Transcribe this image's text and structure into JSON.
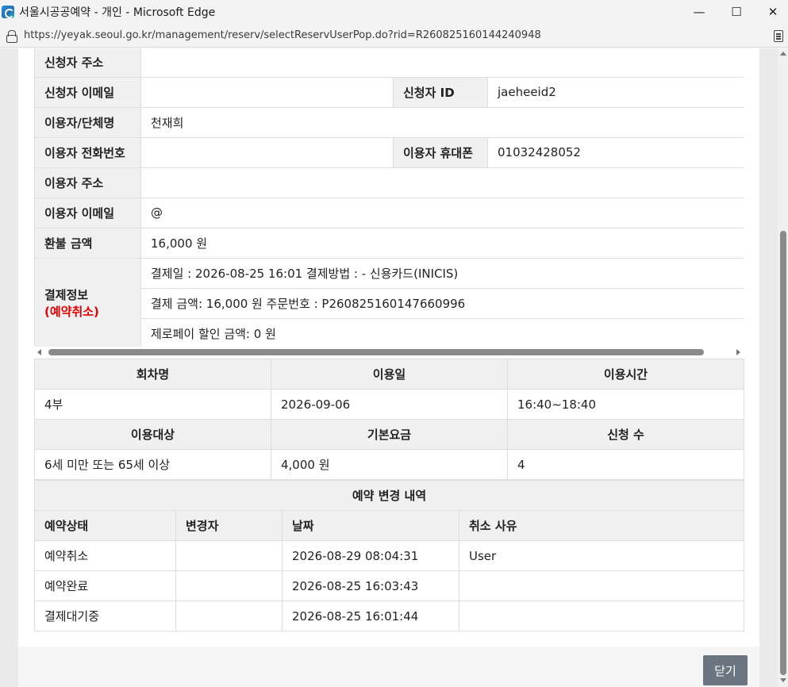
{
  "window": {
    "title": "서울시공공예약 - 개인 - Microsoft Edge",
    "url": "https://yeyak.seoul.go.kr/management/reserv/selectReservUserPop.do?rid=R260825160144240948",
    "controls": {
      "minimize": "—",
      "maximize": "☐",
      "close": "✕"
    }
  },
  "applicant": {
    "address_label": "신청자 주소",
    "address": "",
    "email_label": "신청자 이메일",
    "email": "",
    "id_label": "신청자 ID",
    "id": "jaeheeid2"
  },
  "user": {
    "name_label": "이용자/단체명",
    "name": "천재희",
    "phone_label": "이용자 전화번호",
    "phone": "",
    "mobile_label": "이용자 휴대폰",
    "mobile": "01032428052",
    "address_label": "이용자 주소",
    "address": "",
    "email_label": "이용자 이메일",
    "email": "@"
  },
  "refund": {
    "label": "환불 금액",
    "value": "16,000 원"
  },
  "payment": {
    "label": "결제정보",
    "status": "(예약취소)",
    "line1": "결제일 : 2026-08-25 16:01 결제방법 : - 신용카드(INICIS)",
    "line2": "결제 금액: 16,000 원 주문번호 : P260825160147660996",
    "line3": "제로페이 할인 금액: 0 원"
  },
  "session": {
    "headers": [
      "회차명",
      "이용일",
      "이용시간"
    ],
    "values": [
      "4부",
      "2026-09-06",
      "16:40~18:40"
    ]
  },
  "target": {
    "headers": [
      "이용대상",
      "기본요금",
      "신청 수"
    ],
    "values": [
      "6세 미만 또는 65세 이상",
      "4,000 원",
      "4"
    ]
  },
  "history": {
    "title": "예약 변경 내역",
    "headers": [
      "예약상태",
      "변경자",
      "날짜",
      "취소 사유"
    ],
    "rows": [
      [
        "예약취소",
        "",
        "2026-08-29 08:04:31",
        "User"
      ],
      [
        "예약완료",
        "",
        "2026-08-25 16:03:43",
        ""
      ],
      [
        "결제대기중",
        "",
        "2026-08-25 16:01:44",
        ""
      ]
    ]
  },
  "close_button": "닫기",
  "colors": {
    "header_bg": "#f0f0f0",
    "border": "#dddddd",
    "cancel_red": "#e60000",
    "button_bg": "#6b7580"
  }
}
